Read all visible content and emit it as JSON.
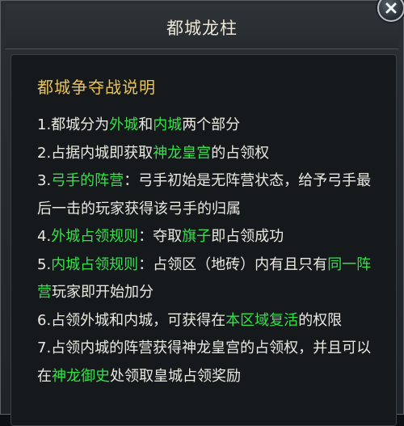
{
  "window": {
    "title": "都城龙柱"
  },
  "panel": {
    "heading": "都城争夺战说明",
    "rules": [
      {
        "segments": [
          {
            "t": "1.都城分为",
            "hl": false
          },
          {
            "t": "外城",
            "hl": true
          },
          {
            "t": "和",
            "hl": false
          },
          {
            "t": "内城",
            "hl": true
          },
          {
            "t": "两个部分",
            "hl": false
          }
        ]
      },
      {
        "segments": [
          {
            "t": "2.占据内城即获取",
            "hl": false
          },
          {
            "t": "神龙皇宫",
            "hl": true
          },
          {
            "t": "的占领权",
            "hl": false
          }
        ]
      },
      {
        "segments": [
          {
            "t": "3.",
            "hl": false
          },
          {
            "t": "弓手的阵营",
            "hl": true
          },
          {
            "t": "：弓手初始是无阵营状态，给予弓手最后一击的玩家获得该弓手的归属",
            "hl": false
          }
        ]
      },
      {
        "segments": [
          {
            "t": "4.",
            "hl": false
          },
          {
            "t": "外城占领规则",
            "hl": true
          },
          {
            "t": "：夺取",
            "hl": false
          },
          {
            "t": "旗子",
            "hl": true
          },
          {
            "t": "即占领成功",
            "hl": false
          }
        ]
      },
      {
        "segments": [
          {
            "t": "5.",
            "hl": false
          },
          {
            "t": "内城占领规则",
            "hl": true
          },
          {
            "t": "：占领区（地砖）内有且只有",
            "hl": false
          },
          {
            "t": "同一阵营",
            "hl": true
          },
          {
            "t": "玩家即开始加分",
            "hl": false
          }
        ]
      },
      {
        "segments": [
          {
            "t": "6.占领外城和内城，可获得在",
            "hl": false
          },
          {
            "t": "本区域复活",
            "hl": true
          },
          {
            "t": "的权限",
            "hl": false
          }
        ]
      },
      {
        "segments": [
          {
            "t": "7.占领内城的阵营获得神龙皇宫的占领权，并且可以在",
            "hl": false
          },
          {
            "t": "神龙御史",
            "hl": true
          },
          {
            "t": "处领取皇城占领奖励",
            "hl": false
          }
        ]
      }
    ]
  },
  "colors": {
    "title": "#ece6d6",
    "heading": "#e8c35a",
    "body_text": "#e9e9e2",
    "highlight": "#35e04a",
    "panel_bg": "#16191c",
    "window_bg": "#2a2f33"
  },
  "icons": {
    "close": "close-icon"
  }
}
